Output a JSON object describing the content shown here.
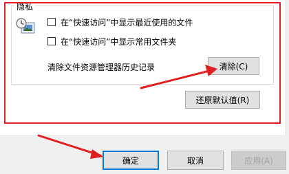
{
  "privacy": {
    "legend": "隐私",
    "show_recent_files": "在“快速访问”中显示最近使用的文件",
    "show_frequent_folders": "在“快速访问”中显示常用文件夹",
    "clear_history_label": "清除文件资源管理器历史记录",
    "clear_button": "清除(C)"
  },
  "restore_defaults_button": "还原默认值(R)",
  "dialog_buttons": {
    "ok": "确定",
    "cancel": "取消",
    "apply": "应用(A)"
  },
  "colors": {
    "annotation_red": "#e02020",
    "focus_blue": "#0078d7"
  },
  "icons": [
    "privacy-clock-icon",
    "arrow-annotation-icon"
  ]
}
